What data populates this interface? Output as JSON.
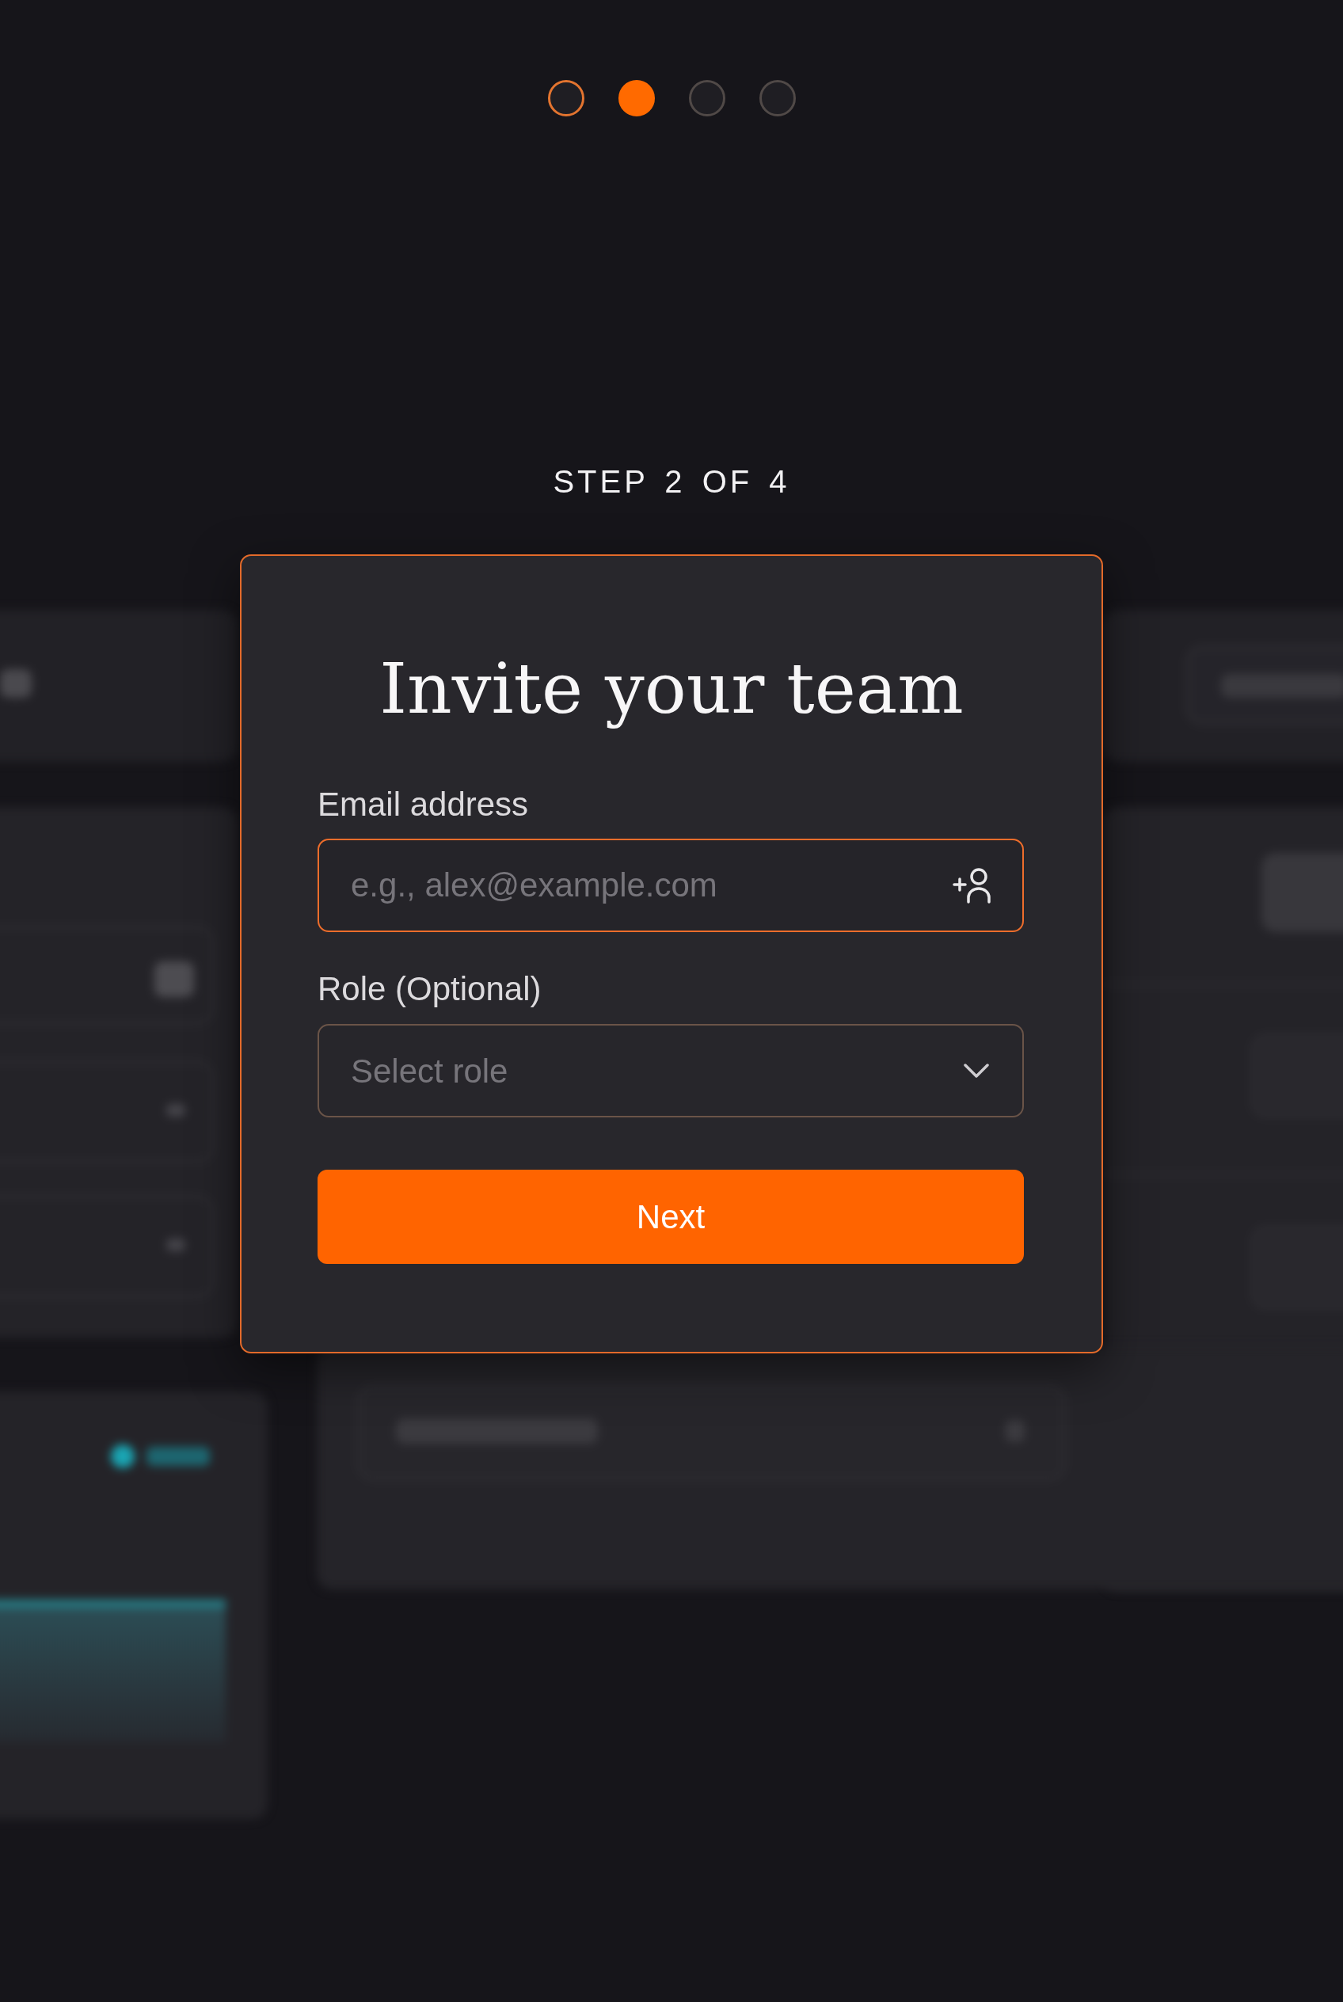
{
  "stepper": {
    "steps": [
      {
        "selected": false,
        "completed": true
      },
      {
        "selected": true,
        "completed": false
      },
      {
        "selected": false,
        "completed": false
      },
      {
        "selected": false,
        "completed": false
      }
    ],
    "label": "STEP 2 OF 4"
  },
  "dialog": {
    "title": "Invite your team",
    "fields": [
      {
        "kind": "email",
        "label": "Email address",
        "placeholder": "e.g., alex@example.com",
        "focused": true
      },
      {
        "kind": "select",
        "label": "Role (Optional)",
        "placeholder": "Select role",
        "focused": false
      }
    ],
    "button": "Next"
  }
}
